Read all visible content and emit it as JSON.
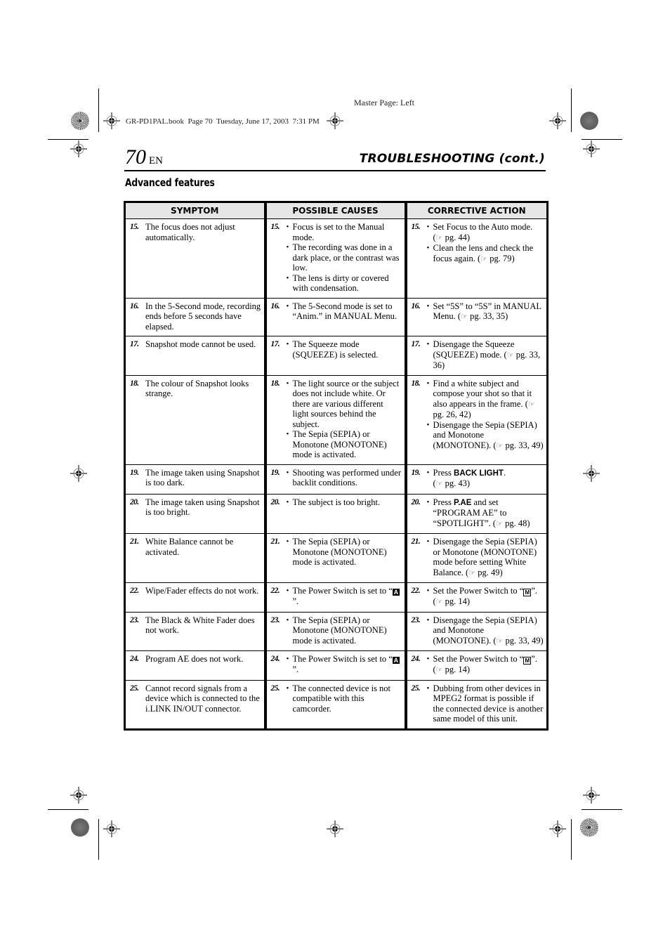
{
  "print_marks": {
    "master_page": "Master Page: Left",
    "book_line": "GR-PD1PAL.book  Page 70  Tuesday, June 17, 2003  7:31 PM"
  },
  "header": {
    "page_number": "70",
    "language": "EN",
    "section_title": "TROUBLESHOOTING (cont.)",
    "subheading": "Advanced features"
  },
  "icons": {
    "reference": "pointing-hand (☞)",
    "switch_auto": "A",
    "switch_manual": "M"
  },
  "table": {
    "headers": [
      "SYMPTOM",
      "POSSIBLE CAUSES",
      "CORRECTIVE ACTION"
    ],
    "rows": [
      {
        "num": "15.",
        "symptom": "The focus does not adjust automatically.",
        "causes": [
          "Focus is set to the Manual mode.",
          "The recording was done in a dark place, or the contrast was low.",
          "The lens is dirty or covered with condensation."
        ],
        "actions": [
          {
            "text": "Set Focus to the Auto mode.",
            "ref": "pg. 44"
          },
          {
            "text": "Clean the lens and check the focus again.",
            "ref": "pg. 79"
          }
        ]
      },
      {
        "num": "16.",
        "symptom": "In the 5-Second mode, recording ends before 5 seconds have elapsed.",
        "causes": [
          "The 5-Second mode is set to “Anim.” in MANUAL Menu."
        ],
        "actions": [
          {
            "text": "Set “5S” to “5S” in MANUAL Menu.",
            "ref": "pg. 33, 35"
          }
        ]
      },
      {
        "num": "17.",
        "symptom": "Snapshot mode cannot be used.",
        "causes": [
          "The Squeeze mode (SQUEEZE) is selected."
        ],
        "actions": [
          {
            "text": "Disengage the Squeeze (SQUEEZE) mode.",
            "ref": "pg. 33, 36"
          }
        ]
      },
      {
        "num": "18.",
        "symptom": "The colour of Snapshot looks strange.",
        "causes": [
          "The light source or the subject does not include white. Or there are various different light sources behind the subject.",
          "The Sepia (SEPIA) or Monotone (MONOTONE) mode is activated."
        ],
        "actions": [
          {
            "text": "Find a white subject and compose your shot so that it also appears in the frame.",
            "ref": "pg. 26, 42"
          },
          {
            "text": "Disengage the Sepia (SEPIA) and Monotone (MONOTONE).",
            "ref": "pg. 33, 49"
          }
        ]
      },
      {
        "num": "19.",
        "symptom": "The image taken using Snapshot is too dark.",
        "causes": [
          "Shooting was performed under backlit conditions."
        ],
        "actions": [
          {
            "pre": "Press ",
            "bold": "BACK LIGHT",
            "post": ".",
            "ref": "pg. 43"
          }
        ]
      },
      {
        "num": "20.",
        "symptom": "The image taken using Snapshot is too bright.",
        "causes": [
          "The subject is too bright."
        ],
        "actions": [
          {
            "pre": "Press ",
            "bold": "P.AE",
            "post": " and set “PROGRAM AE” to “SPOTLIGHT”.",
            "ref": "pg. 48"
          }
        ]
      },
      {
        "num": "21.",
        "symptom": "White Balance cannot be activated.",
        "causes": [
          "The Sepia (SEPIA) or Monotone (MONOTONE) mode is activated."
        ],
        "actions": [
          {
            "text": "Disengage the Sepia (SEPIA) or Monotone (MONOTONE) mode before setting White Balance.",
            "ref": "pg. 49"
          }
        ]
      },
      {
        "num": "22.",
        "symptom": "Wipe/Fader effects do not work.",
        "causes_switch": {
          "pre": "The Power Switch is set to “",
          "post": "”."
        },
        "actions_switch": {
          "pre": "Set the Power Switch to “",
          "post": "”.",
          "ref": "pg. 14"
        }
      },
      {
        "num": "23.",
        "symptom": "The Black & White Fader does not work.",
        "causes": [
          "The Sepia (SEPIA) or Monotone (MONOTONE) mode is activated."
        ],
        "actions": [
          {
            "text": "Disengage the Sepia (SEPIA) and Monotone (MONOTONE).",
            "ref": "pg. 33, 49"
          }
        ]
      },
      {
        "num": "24.",
        "symptom": "Program AE does not work.",
        "causes_switch": {
          "pre": "The Power Switch is set to “",
          "post": "”."
        },
        "actions_switch": {
          "pre": "Set the Power Switch to “",
          "post": "”.",
          "ref": "pg. 14"
        }
      },
      {
        "num": "25.",
        "symptom": "Cannot record signals from a device which is connected to the i.LINK IN/OUT connector.",
        "causes": [
          "The connected device is not compatible with this camcorder."
        ],
        "actions": [
          {
            "text": "Dubbing from other devices in MPEG2 format is possible if the connected device is another same model of this unit."
          }
        ]
      }
    ]
  }
}
